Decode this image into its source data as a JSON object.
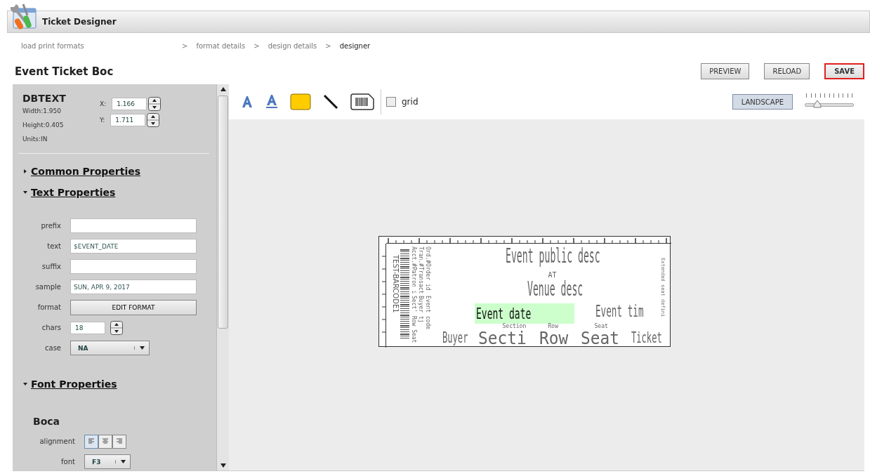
{
  "app": {
    "title": "Ticket Designer"
  },
  "breadcrumb": [
    {
      "label": "load print formats",
      "current": false
    },
    {
      "label": "format details",
      "current": false
    },
    {
      "label": "design details",
      "current": false
    },
    {
      "label": "designer",
      "current": true
    }
  ],
  "breadcrumb_separator": ">",
  "page_title": "Event Ticket Boc",
  "actions": [
    {
      "label": "PREVIEW",
      "primary": false
    },
    {
      "label": "RELOAD",
      "primary": false
    },
    {
      "label": "SAVE",
      "primary": true
    }
  ],
  "panel": {
    "element_type": "DBTEXT",
    "width": "Width:1.950",
    "height": "Height:0.405",
    "units": "Units:IN",
    "x": {
      "label": "X:",
      "value": "1.166"
    },
    "y": {
      "label": "Y:",
      "value": "1.711"
    },
    "sections": [
      {
        "title": "Common Properties",
        "expanded": false
      },
      {
        "title": "Text Properties",
        "expanded": true
      }
    ],
    "text_fields": [
      {
        "kind": "field",
        "label": "prefix"
      },
      {
        "kind": "field",
        "label": "text",
        "value": "$EVENT_DATE"
      },
      {
        "kind": "field",
        "label": "suffix"
      },
      {
        "kind": "field",
        "label": "sample",
        "value": "SUN, APR 9, 2017"
      },
      {
        "kind": "button",
        "label": "format",
        "value": "EDIT FORMAT"
      },
      {
        "kind": "spinner",
        "label": "chars",
        "value": "18"
      },
      {
        "kind": "select",
        "label": "case",
        "value": "NA"
      }
    ],
    "font_section": {
      "title": "Font Properties",
      "expanded": true
    },
    "printer": "Boca",
    "alignment": {
      "label": "alignment",
      "options": [
        {
          "kind": "left",
          "selected": true
        },
        {
          "kind": "center",
          "selected": false
        },
        {
          "kind": "right",
          "selected": false
        }
      ]
    },
    "font": {
      "label": "font",
      "value": "F3"
    }
  },
  "toolbar": {
    "grid": {
      "label": "grid",
      "checked": false
    },
    "orientation": {
      "label": "LANDSCAPE",
      "selected": true
    },
    "zoom": {
      "level": 0.2
    }
  },
  "ticket": {
    "barcode_caption": "TEST-BARCODE1",
    "side_fields": [
      [
        "Acct.#Patron i",
        "Sect' Row Seat"
      ],
      [
        "Tran.#Transact",
        "Buyer tj"
      ],
      [
        "Ord.#Order id",
        "Event code"
      ]
    ],
    "title": "Event public desc",
    "at": "AT",
    "venue": "Venue desc",
    "date": {
      "text": "Event date",
      "selected": true
    },
    "time": "Event tim",
    "captions": [
      "Section",
      "Row",
      "Seat"
    ],
    "bottom_fields": [
      "Buyer",
      "Secti",
      "Row",
      "Seat",
      "Ticket"
    ],
    "right_field": "Extended seat defini"
  }
}
